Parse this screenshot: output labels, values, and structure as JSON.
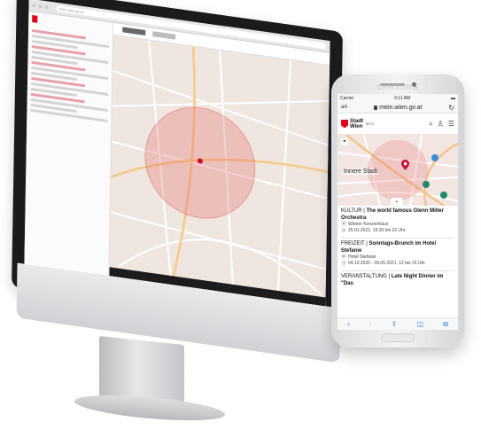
{
  "desktop": {
    "browser_url": "mein.wien.gv.at"
  },
  "phone": {
    "brand": "SAMSUNG",
    "status": {
      "carrier": "Carrier",
      "time": "9:11 AM"
    },
    "browser": {
      "text_size": "aA",
      "url": "mein.wien.gv.at"
    },
    "header": {
      "logo_line1": "Stadt",
      "logo_line2": "Wien",
      "beta": "BETA"
    },
    "map": {
      "label": "Innere Stadt"
    },
    "events": [
      {
        "category": "KULTUR |",
        "title": "The world famous Glenn Miller Orchestra",
        "venue": "Wiener Konzerthaus",
        "date": "25.01.2021, 19.30 bis 22 Uhr"
      },
      {
        "category": "FREIZEIT |",
        "title": "Sonntags-Brunch im Hotel Stefanie",
        "venue": "Hotel Stefanie",
        "date": "04.10.2020 - 09.05.2021, 12 bis 15 Uhr"
      },
      {
        "category": "VERANSTALTUNG |",
        "title": "Late Night Dinner im \"Das"
      }
    ],
    "toolbar_icons": [
      "back-icon",
      "forward-icon",
      "share-icon",
      "bookmarks-icon",
      "tabs-icon"
    ]
  },
  "colors": {
    "brand_red": "#e2001a",
    "safari_blue": "#2a7ae4"
  }
}
